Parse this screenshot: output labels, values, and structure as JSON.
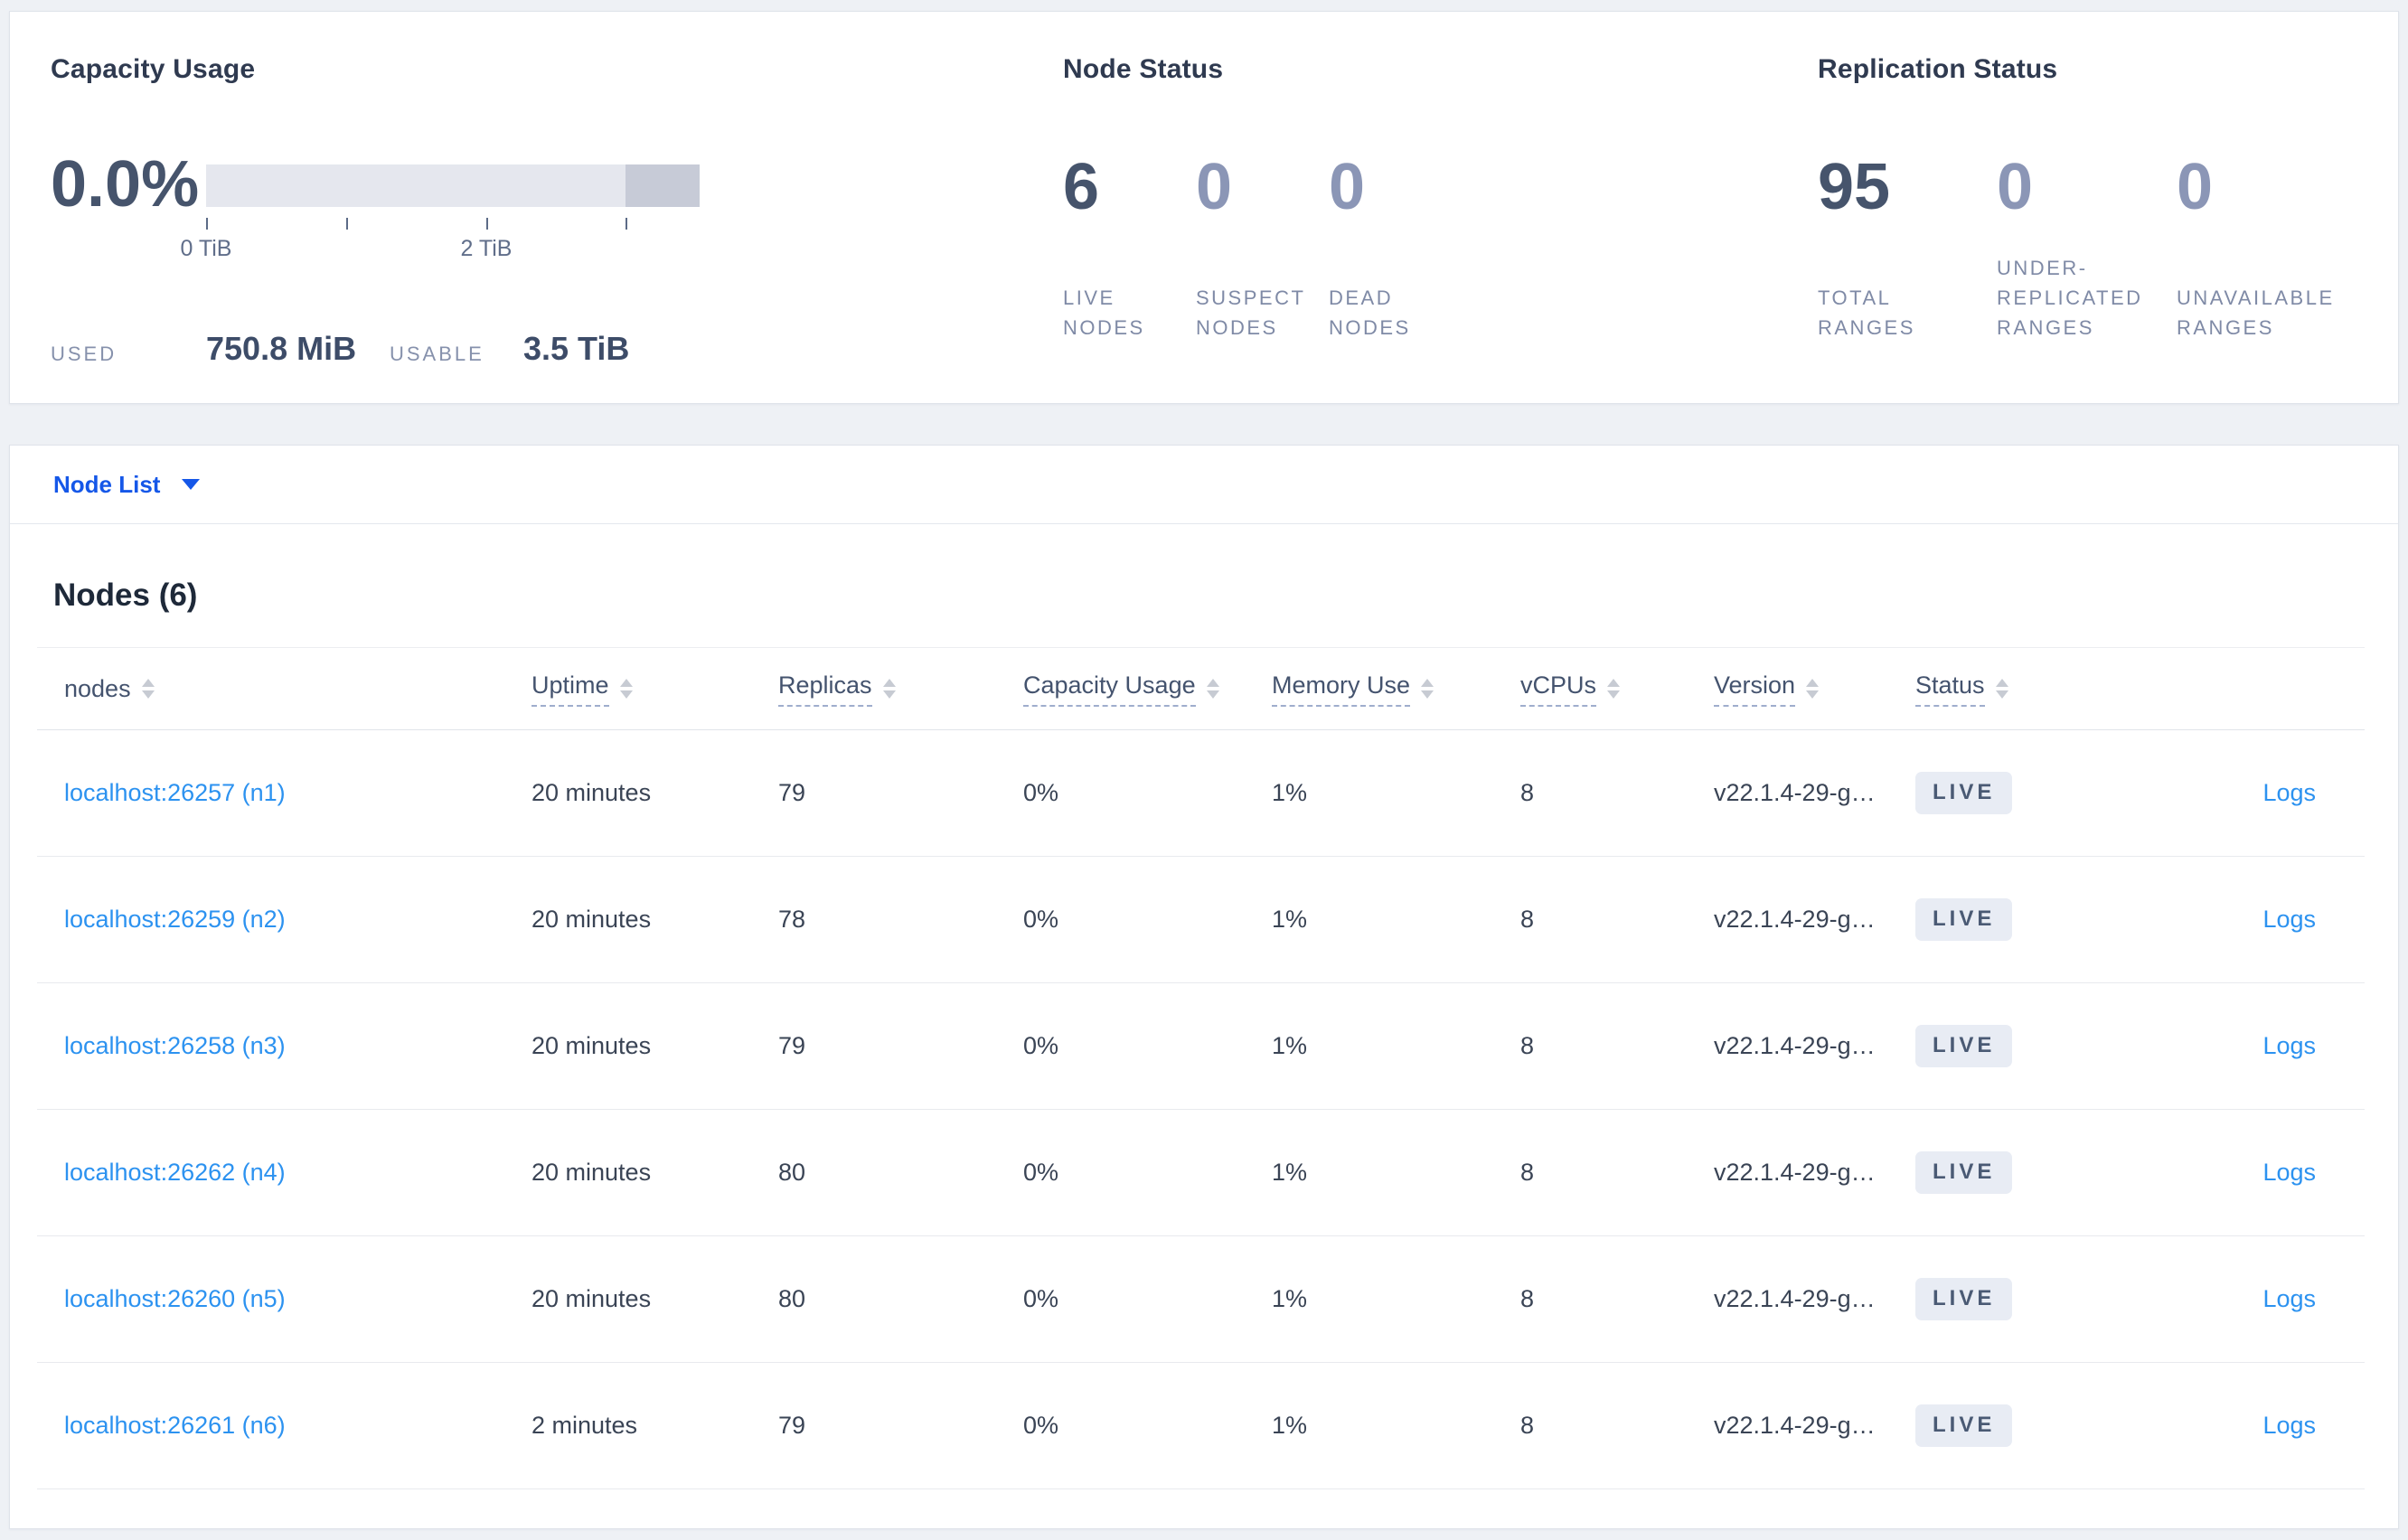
{
  "summary": {
    "capacity": {
      "title": "Capacity Usage",
      "percent": "0.0%",
      "used_label": "USED",
      "used_value": "750.8 MiB",
      "usable_label": "USABLE",
      "usable_value": "3.5 TiB",
      "ticks": [
        "0 TiB",
        "2 TiB"
      ],
      "chart": {
        "type": "bar",
        "range_tib": [
          0,
          3.5
        ],
        "tick_interval_tib": 1,
        "used_fraction": 0.0,
        "note": "gauge of used vs usable disk; darker tail segment near 3-3.5 TiB"
      }
    },
    "node_status": {
      "title": "Node Status",
      "stats": [
        {
          "value": "6",
          "label": "LIVE\nNODES"
        },
        {
          "value": "0",
          "label": "SUSPECT\nNODES"
        },
        {
          "value": "0",
          "label": "DEAD\nNODES"
        }
      ]
    },
    "replication_status": {
      "title": "Replication Status",
      "stats": [
        {
          "value": "95",
          "label": "TOTAL\nRANGES"
        },
        {
          "value": "0",
          "label": "UNDER-\nREPLICATED\nRANGES"
        },
        {
          "value": "0",
          "label": "UNAVAILABLE\nRANGES"
        }
      ]
    }
  },
  "node_list": {
    "dropdown_label": "Node List",
    "heading": "Nodes (6)"
  },
  "table": {
    "columns": [
      "nodes",
      "Uptime",
      "Replicas",
      "Capacity Usage",
      "Memory Use",
      "vCPUs",
      "Version",
      "Status"
    ],
    "rows": [
      {
        "node": "localhost:26257 (n1)",
        "uptime": "20 minutes",
        "replicas": "79",
        "capacity_usage": "0%",
        "memory_use": "1%",
        "vcpus": "8",
        "version": "v22.1.4-29-g…",
        "status": "LIVE",
        "logs": "Logs"
      },
      {
        "node": "localhost:26259 (n2)",
        "uptime": "20 minutes",
        "replicas": "78",
        "capacity_usage": "0%",
        "memory_use": "1%",
        "vcpus": "8",
        "version": "v22.1.4-29-g…",
        "status": "LIVE",
        "logs": "Logs"
      },
      {
        "node": "localhost:26258 (n3)",
        "uptime": "20 minutes",
        "replicas": "79",
        "capacity_usage": "0%",
        "memory_use": "1%",
        "vcpus": "8",
        "version": "v22.1.4-29-g…",
        "status": "LIVE",
        "logs": "Logs"
      },
      {
        "node": "localhost:26262 (n4)",
        "uptime": "20 minutes",
        "replicas": "80",
        "capacity_usage": "0%",
        "memory_use": "1%",
        "vcpus": "8",
        "version": "v22.1.4-29-g…",
        "status": "LIVE",
        "logs": "Logs"
      },
      {
        "node": "localhost:26260 (n5)",
        "uptime": "20 minutes",
        "replicas": "80",
        "capacity_usage": "0%",
        "memory_use": "1%",
        "vcpus": "8",
        "version": "v22.1.4-29-g…",
        "status": "LIVE",
        "logs": "Logs"
      },
      {
        "node": "localhost:26261 (n6)",
        "uptime": "2 minutes",
        "replicas": "79",
        "capacity_usage": "0%",
        "memory_use": "1%",
        "vcpus": "8",
        "version": "v22.1.4-29-g…",
        "status": "LIVE",
        "logs": "Logs"
      }
    ]
  },
  "colors": {
    "accent_blue": "#1557e8",
    "link_blue": "#2c92f0",
    "dark_number": "#46546c",
    "muted_number": "#8b96b6",
    "badge_bg": "#e8ecf4"
  }
}
